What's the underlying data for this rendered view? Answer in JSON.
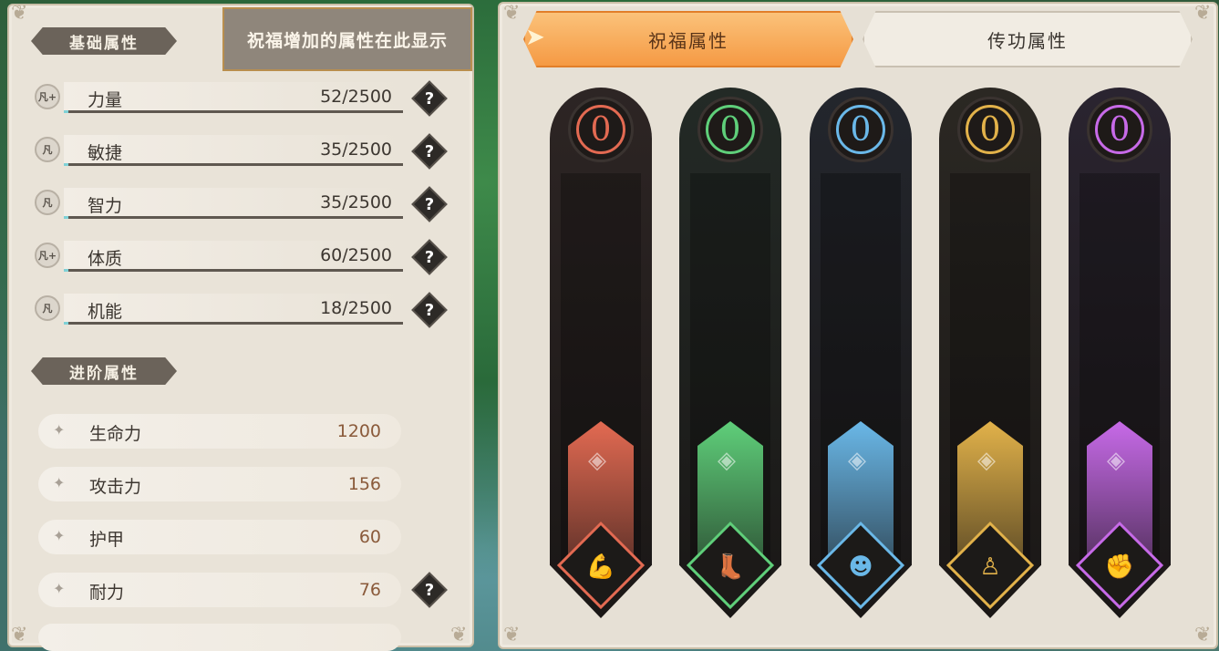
{
  "base_section": {
    "title": "基础属性"
  },
  "tooltip": {
    "text": "祝福增加的属性在此显示"
  },
  "base_attributes": [
    {
      "icon_label": "凡+",
      "name": "力量",
      "value": "52/2500"
    },
    {
      "icon_label": "凡",
      "name": "敏捷",
      "value": "35/2500"
    },
    {
      "icon_label": "凡",
      "name": "智力",
      "value": "35/2500"
    },
    {
      "icon_label": "凡+",
      "name": "体质",
      "value": "60/2500"
    },
    {
      "icon_label": "凡",
      "name": "机能",
      "value": "18/2500"
    }
  ],
  "help_label": "?",
  "advanced_section": {
    "title": "进阶属性"
  },
  "advanced_attributes": [
    {
      "name": "生命力",
      "value": "1200"
    },
    {
      "name": "攻击力",
      "value": "156"
    },
    {
      "name": "护甲",
      "value": "60"
    },
    {
      "name": "耐力",
      "value": "76"
    }
  ],
  "tabs": [
    {
      "label": "祝福属性",
      "active": true
    },
    {
      "label": "传功属性",
      "active": false
    }
  ],
  "pillars": [
    {
      "name": "strength",
      "count": "0",
      "color": "#e36a52",
      "emblem_icon": "muscle-arm-icon",
      "glyph": "💪"
    },
    {
      "name": "agility",
      "count": "0",
      "color": "#5fcf7a",
      "emblem_icon": "winged-boot-icon",
      "glyph": "👢"
    },
    {
      "name": "intellect",
      "count": "0",
      "color": "#6ab8e8",
      "emblem_icon": "head-icon",
      "glyph": "☻"
    },
    {
      "name": "constitution",
      "count": "0",
      "color": "#e2b24a",
      "emblem_icon": "body-icon",
      "glyph": "♙"
    },
    {
      "name": "function",
      "count": "0",
      "color": "#c76ae8",
      "emblem_icon": "fist-icon",
      "glyph": "✊"
    }
  ]
}
